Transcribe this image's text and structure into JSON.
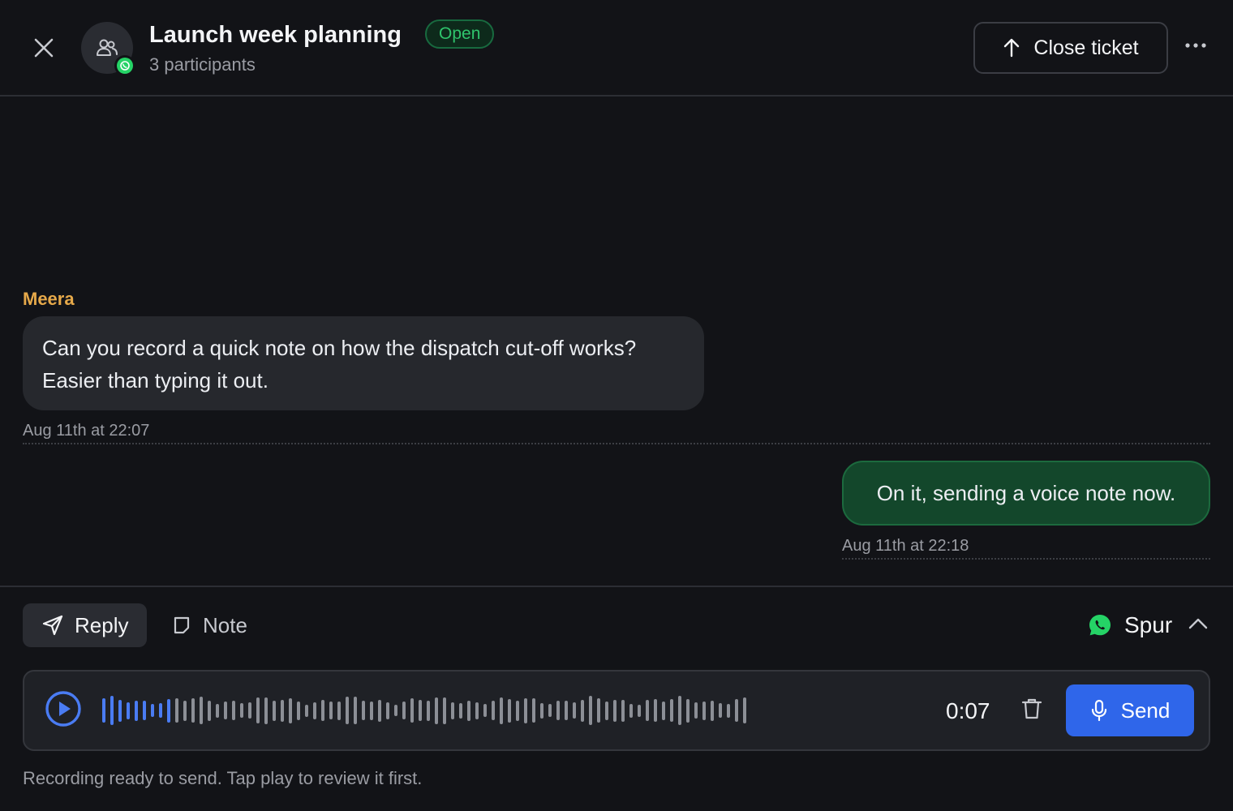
{
  "header": {
    "title": "Launch week planning",
    "status": "Open",
    "subtitle": "3 participants",
    "close_ticket_label": "Close ticket",
    "icons": {
      "close": "close-icon",
      "avatar": "group-users-icon",
      "channel_badge": "whatsapp-icon",
      "close_ticket": "arrow-up-icon",
      "more": "more-horizontal-icon"
    }
  },
  "messages": [
    {
      "sender": "Meera",
      "text": "Can you record a quick note on how the dispatch cut-off works? Easier than typing it out.",
      "time": "Aug 11th at 22:07",
      "direction": "incoming"
    },
    {
      "text": "On it, sending a voice note now.",
      "time": "Aug 11th at 22:18",
      "direction": "outgoing"
    }
  ],
  "composer": {
    "tabs": [
      {
        "label": "Reply",
        "active": true,
        "icon": "send-arrow-icon"
      },
      {
        "label": "Note",
        "active": false,
        "icon": "note-icon"
      }
    ],
    "channel_label": "Spur",
    "channel_icon": "whatsapp-icon",
    "recording": {
      "duration": "0:07",
      "playback_progress": 0.11,
      "send_label": "Send",
      "helper": "Recording ready to send. Tap play to review it first."
    }
  },
  "colors": {
    "background": "#121317",
    "sender_name": "#e6a94a",
    "status_green": "#2fc46c",
    "outgoing_bubble": "#13472b",
    "accent_blue": "#2f66ea",
    "whatsapp_green": "#25d366"
  }
}
